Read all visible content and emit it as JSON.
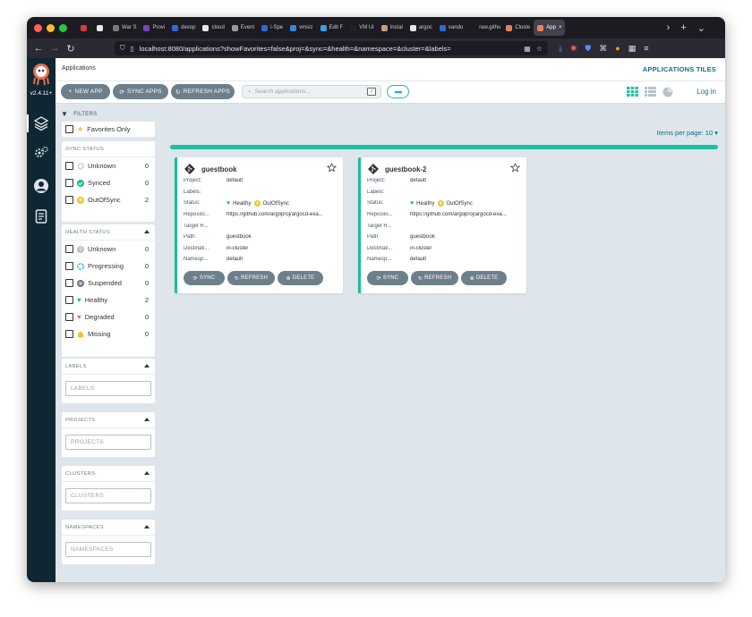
{
  "browser": {
    "tabs": [
      {
        "label": "",
        "color": "#d63b3b"
      },
      {
        "label": "",
        "color": "#e8e8e8"
      },
      {
        "label": "War S",
        "color": "#7a7a7a"
      },
      {
        "label": "Provi",
        "color": "#7b42bc"
      },
      {
        "label": "devop",
        "color": "#2f6ad1"
      },
      {
        "label": "cloud",
        "color": "#e8e8e8"
      },
      {
        "label": "Event",
        "color": "#9a9a9a"
      },
      {
        "label": "i-Spe",
        "color": "#2f6ad1"
      },
      {
        "label": "vmsiz",
        "color": "#3a86d4"
      },
      {
        "label": "Edit F",
        "color": "#3aa0e6"
      },
      {
        "label": "VM Ui",
        "color": "#222222"
      },
      {
        "label": "Instal",
        "color": "#c0a080"
      },
      {
        "label": "argoc",
        "color": "#e8e8e8"
      },
      {
        "label": "vandu",
        "color": "#2f6ad1"
      },
      {
        "label": "raw.githu",
        "color": "#1c1b22"
      },
      {
        "label": "Cluste",
        "color": "#e8805a"
      },
      {
        "label": "App",
        "color": "#e8805a"
      }
    ],
    "url": "localhost:8080/applications?showFavorites=false&proj=&sync=&health=&namespace=&cluster=&labels="
  },
  "app": {
    "version": "v2.4.11+",
    "breadcrumb": "Applications",
    "view_title": "APPLICATIONS TILES",
    "login": "Log in"
  },
  "toolbar": {
    "new_app": "NEW APP",
    "sync_apps": "SYNC APPS",
    "refresh_apps": "REFRESH APPS",
    "search_placeholder": "Search applications...",
    "search_key": "/"
  },
  "filters": {
    "title": "FILTERS",
    "favorites_only": "Favorites Only",
    "sync_status": {
      "title": "SYNC STATUS",
      "items": [
        {
          "label": "Unknown",
          "count": "0"
        },
        {
          "label": "Synced",
          "count": "0"
        },
        {
          "label": "OutOfSync",
          "count": "2"
        }
      ]
    },
    "health_status": {
      "title": "HEALTH STATUS",
      "items": [
        {
          "label": "Unknown",
          "count": "0"
        },
        {
          "label": "Progressing",
          "count": "0"
        },
        {
          "label": "Suspended",
          "count": "0"
        },
        {
          "label": "Healthy",
          "count": "2"
        },
        {
          "label": "Degraded",
          "count": "0"
        },
        {
          "label": "Missing",
          "count": "0"
        }
      ]
    },
    "labels": {
      "title": "LABELS",
      "placeholder": "LABELS"
    },
    "projects": {
      "title": "PROJECTS",
      "placeholder": "PROJECTS"
    },
    "clusters": {
      "title": "CLUSTERS",
      "placeholder": "CLUSTERS"
    },
    "namespaces": {
      "title": "NAMESPACES",
      "placeholder": "NAMESPACES"
    }
  },
  "content": {
    "items_per_page": "Items per page: 10 ▾",
    "apps": [
      {
        "name": "guestbook",
        "fields": [
          {
            "k": "Project:",
            "v": "default"
          },
          {
            "k": "Labels:",
            "v": ""
          },
          {
            "k": "Status:",
            "v": ""
          },
          {
            "k": "Reposito...",
            "v": "https://github.com/argoproj/argocd-exa..."
          },
          {
            "k": "Target R...",
            "v": ""
          },
          {
            "k": "Path:",
            "v": "guestbook"
          },
          {
            "k": "Destinati...",
            "v": "in-cluster"
          },
          {
            "k": "Namesp...",
            "v": "default"
          }
        ],
        "health": "Healthy",
        "sync": "OutOfSync"
      },
      {
        "name": "guestbook-2",
        "fields": [
          {
            "k": "Project:",
            "v": "default"
          },
          {
            "k": "Labels:",
            "v": ""
          },
          {
            "k": "Status:",
            "v": ""
          },
          {
            "k": "Reposito...",
            "v": "https://github.com/argoproj/argocd-exa..."
          },
          {
            "k": "Target R...",
            "v": ""
          },
          {
            "k": "Path:",
            "v": "guestbook"
          },
          {
            "k": "Destinati...",
            "v": "in-cluster"
          },
          {
            "k": "Namesp...",
            "v": "default"
          }
        ],
        "health": "Healthy",
        "sync": "OutOfSync"
      }
    ],
    "card_buttons": {
      "sync": "SYNC",
      "refresh": "REFRESH",
      "delete": "DELETE"
    }
  },
  "colors": {
    "accent": "#1fbea5",
    "healthy": "#18be94",
    "out_of_sync": "#f4c030",
    "sidebar": "#0f2733"
  }
}
